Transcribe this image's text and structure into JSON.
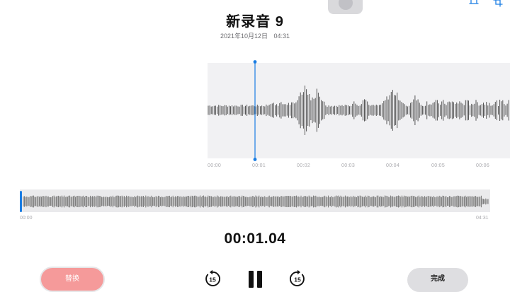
{
  "header": {
    "corner_label": "",
    "title": "新录音 9",
    "date": "2021年10月12日",
    "duration": "04:31"
  },
  "icons": {
    "trim": "trim-icon",
    "crop": "crop-icon",
    "skip_back": "skip-back-15-icon",
    "skip_forward": "skip-forward-15-icon",
    "pause": "pause-icon"
  },
  "waveform": {
    "ticks": [
      "00:00",
      "00:01",
      "00:02",
      "00:03",
      "00:04",
      "00:05",
      "00:06"
    ],
    "playhead_label": "00:01"
  },
  "overview": {
    "start_label": "00:00",
    "end_label": "04:31"
  },
  "playback": {
    "current_time": "00:01.04",
    "skip_back_label": "15",
    "skip_forward_label": "15"
  },
  "buttons": {
    "replace_label": "替换",
    "done_label": "完成"
  },
  "colors": {
    "accent": "#1a7de3",
    "replace_bg": "#f59a9a",
    "wave": "#555555",
    "wave_bg": "#f1f1f3"
  }
}
